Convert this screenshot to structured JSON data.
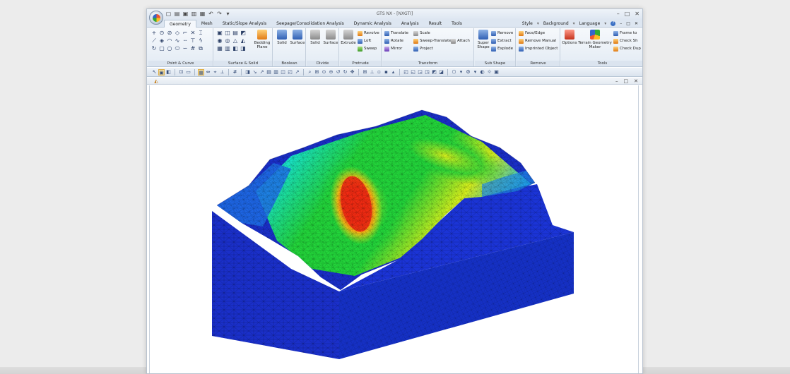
{
  "window": {
    "title": "GTS NX - [NXGTI]"
  },
  "menu_tabs": [
    "Geometry",
    "Mesh",
    "Static/Slope Analysis",
    "Seepage/Consolidation Analysis",
    "Dynamic Analysis",
    "Analysis",
    "Result",
    "Tools"
  ],
  "menu_right": {
    "style": "Style",
    "background": "Background",
    "language": "Language"
  },
  "ribbon": {
    "point_curve": {
      "label": "Point & Curve"
    },
    "surface_solid": {
      "label": "Surface & Solid",
      "bedding_plane": "Bedding Plane"
    },
    "boolean": {
      "label": "Boolean",
      "solid": "Solid",
      "surface": "Surface"
    },
    "divide": {
      "label": "Divide",
      "solid": "Solid",
      "surface": "Surface"
    },
    "protrude": {
      "label": "Protrude",
      "extrude": "Extrude",
      "revolve": "Revolve",
      "loft": "Loft",
      "sweep": "Sweep"
    },
    "transform": {
      "label": "Transform",
      "translate": "Translate",
      "rotate": "Rotate",
      "mirror": "Mirror",
      "scale": "Scale",
      "sweep_translate": "Sweep-Translate",
      "project": "Project",
      "attach": "Attach"
    },
    "sub_shape": {
      "label": "Sub Shape",
      "super_shape": "Super Shape",
      "remove": "Remove",
      "extract": "Extract",
      "explode": "Explode"
    },
    "remove": {
      "label": "Remove",
      "face_edge": "Face/Edge",
      "remove_manual": "Remove Manual",
      "imprinted_object": "Imprinted Object"
    },
    "tools": {
      "label": "Tools",
      "options": "Options",
      "terrain_geometry_maker": "Terrain Geometry Maker",
      "frame_to": "Frame to",
      "check_sh": "Check Sh",
      "check_dup": "Check Dup"
    }
  },
  "icons": {
    "theme_accent": "#3a6fc4",
    "contour_colors": [
      "#1a2fc9",
      "#00a0ff",
      "#18e2c8",
      "#22d43a",
      "#d6ef1c",
      "#f5b515",
      "#ee2a12"
    ]
  }
}
